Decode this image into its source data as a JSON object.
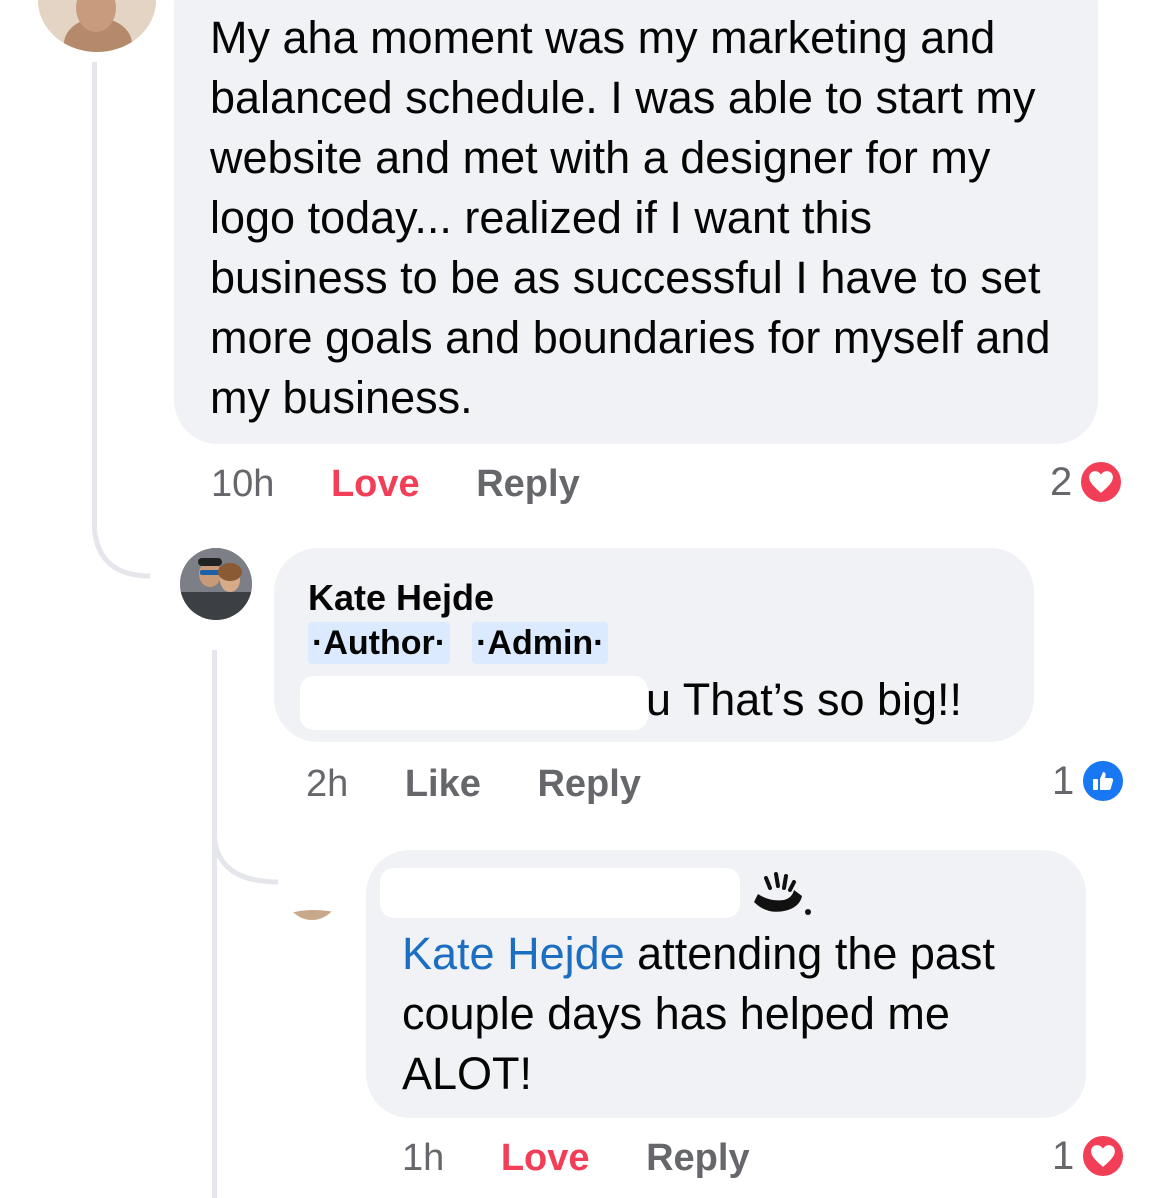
{
  "comments": [
    {
      "text": "My aha moment was my marketing and balanced schedule.  I was able to start my website and met with a designer for my logo today... realized if I want this business to be as successful I have to set more goals and boundaries for myself and my business.",
      "time": "10h",
      "action_primary": "Love",
      "action_reply": "Reply",
      "reaction_count": "2",
      "reaction_type": "heart-icon",
      "reaction_color": "#f33e58"
    },
    {
      "author": "Kate Hejde",
      "badges": [
        "·Author·",
        "·Admin·"
      ],
      "text_tail": "u That’s so big!!",
      "time": "2h",
      "action_primary": "Like",
      "action_reply": "Reply",
      "reaction_count": "1",
      "reaction_type": "thumbs-up-icon",
      "reaction_color": "#1877f2"
    },
    {
      "mention": "Kate Hejde",
      "text": " attending the past couple days has helped me ALOT!",
      "time": "1h",
      "action_primary": "Love",
      "action_reply": "Reply",
      "reaction_count": "1",
      "reaction_type": "heart-icon",
      "reaction_color": "#f33e58"
    }
  ],
  "colors": {
    "bubble": "#f0f2f5",
    "mention": "#1b6ec2",
    "love": "#f33e58",
    "secondary_text": "#65676b"
  }
}
